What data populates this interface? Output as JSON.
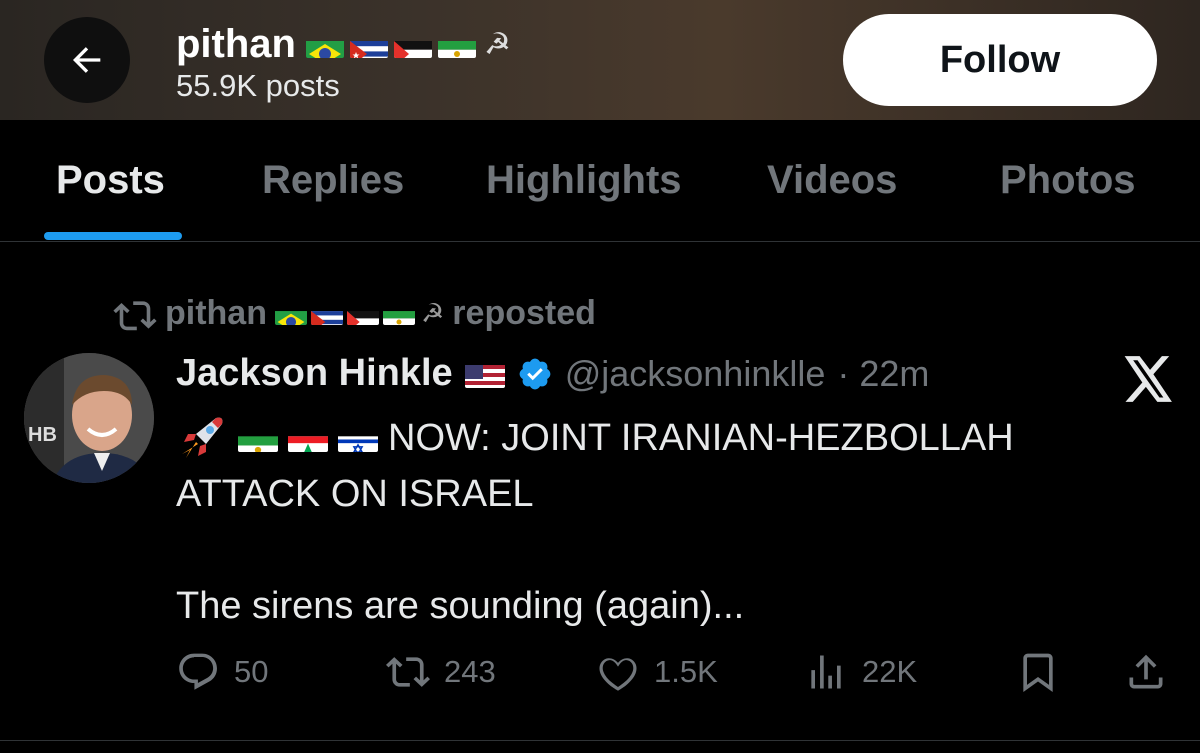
{
  "header": {
    "profile_name": "pithan",
    "post_count": "55.9K posts",
    "follow_label": "Follow",
    "name_emoji": [
      "flag-brazil",
      "flag-cuba",
      "flag-palestine",
      "flag-iran-lion",
      "hammer-and-sickle"
    ]
  },
  "tabs": [
    {
      "label": "Posts",
      "active": true
    },
    {
      "label": "Replies",
      "active": false
    },
    {
      "label": "Highlights",
      "active": false
    },
    {
      "label": "Videos",
      "active": false
    },
    {
      "label": "Photos",
      "active": false
    }
  ],
  "post": {
    "repost_by": "pithan",
    "repost_suffix": "reposted",
    "author": "Jackson Hinkle",
    "author_flag": "flag-usa",
    "verified": true,
    "handle": "@jacksonhinklle",
    "time": "· 22m",
    "text_emoji": [
      "rocket",
      "flag-iran-lion",
      "flag-lebanon",
      "flag-israel"
    ],
    "text_line1": "NOW: JOINT IRANIAN-HEZBOLLAH",
    "text_line2": "ATTACK ON ISRAEL",
    "text_line3": "The sirens are sounding (again)...",
    "stats": {
      "replies": "50",
      "reposts": "243",
      "likes": "1.5K",
      "views": "22K"
    }
  },
  "colors": {
    "accent": "#1d9bf0",
    "muted_text": "#71767b",
    "primary_text": "#e7e9ea",
    "background": "#000000"
  }
}
